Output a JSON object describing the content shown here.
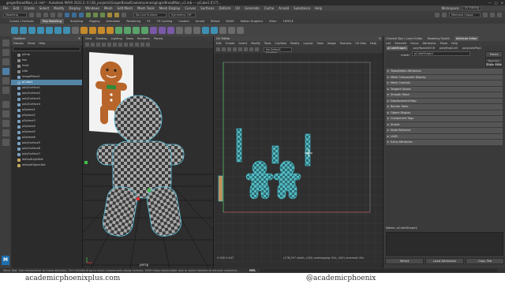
{
  "window": {
    "title": "gingerBreadMan_v1.mb* - Autodesk MAYA 2022.2: E:\\3D_projects\\GingerBreadCookie\\scenes\\gingerBreadMan_v1.mb --- pCube1.f[17]..."
  },
  "menubar": {
    "items": [
      "File",
      "Edit",
      "Create",
      "Select",
      "Modify",
      "Display",
      "Windows",
      "Mesh",
      "Edit Mesh",
      "Mesh Tools",
      "Mesh Display",
      "Curves",
      "Surfaces",
      "Deform",
      "UV",
      "Generate",
      "Cache",
      "Arnold",
      "Substance",
      "Help"
    ],
    "workspace_label": "Workspace:",
    "workspace_value": "UV Editing"
  },
  "status_line": {
    "mode": "Modeling",
    "surface": "No Live Surface",
    "symmetry": "Symmetry: Off",
    "user": "Memoria Coppa"
  },
  "shelf": {
    "tabs": [
      "Curves / Surfaces",
      "Poly Modeling",
      "Sculpting",
      "Rigging",
      "Animation",
      "Rendering",
      "FX",
      "FX Caching",
      "Custom",
      "Arnold",
      "Bifrost",
      "MASH",
      "Motion Graphics",
      "XGen",
      "TURTLE"
    ],
    "active_tab": "Poly Modeling"
  },
  "outliner": {
    "title": "Outliner",
    "menu": [
      "Display",
      "Show",
      "Help"
    ],
    "search_placeholder": "",
    "items": [
      "persp",
      "top",
      "front",
      "side",
      "imagePlane1",
      "pCube1",
      "polySurface1",
      "polySurface2",
      "polySurface3",
      "polySurface4",
      "pSphere1",
      "pSphere2",
      "pSphere3",
      "pSphere4",
      "pSphere5",
      "pSphere6",
      "polySurface5",
      "polySurface6",
      "polySurface7",
      "defaultLightSet",
      "defaultObjectSet"
    ],
    "selected": "pCube1"
  },
  "viewport": {
    "menu": [
      "View",
      "Shading",
      "Lighting",
      "Show",
      "Renderer",
      "Panels"
    ],
    "camera_label": "persp"
  },
  "uv_editor": {
    "title": "UV Editor",
    "menu": [
      "Edit",
      "Create",
      "Select",
      "Modify",
      "Tools",
      "Cut/Sew",
      "Modify",
      "Layout",
      "View",
      "Image",
      "Textures",
      "UV Sets",
      "Help"
    ],
    "uv_set": "No Default Shading",
    "coords": "0.000  0.447",
    "stats_text": "(178,197 shells, (0/0) overlapping UVs, (0/0) reversed UVs"
  },
  "attribute_editor": {
    "tabs": [
      "Channel Box / Layer Editor",
      "Modeling Toolkit",
      "Attribute Editor"
    ],
    "active_tab": "Attribute Editor",
    "header_tabs": [
      "List",
      "Selected",
      "Focus",
      "Attributes",
      "Show",
      "Help"
    ],
    "node_tabs": [
      "pCubeShape1",
      "polyTweakUV16",
      "polyMapCut3",
      "polyAutoProj1"
    ],
    "mesh_label": "mesh:",
    "mesh_value": "pCubeShape1",
    "buttons": [
      "Focus",
      "Presets",
      "Show",
      "Hide"
    ],
    "sections": [
      "Tessellation Attributes",
      "Mesh Component Display",
      "Mesh Controls",
      "Tangent Space",
      "Smooth Mesh",
      "Displacement Map",
      "Render Stats",
      "Object Display",
      "Component Tags",
      "Arnold",
      "Node Behavior",
      "UUID",
      "Extra Attributes"
    ],
    "notes_label": "Notes:",
    "notes_value": "pCubeShape1",
    "bottom_buttons": [
      "Select",
      "Load Attributes",
      "Copy Tab"
    ]
  },
  "helpline": {
    "text": "Move Tool: Use manipulator to move object(s). Ctrl+middle-drag to move components along normals. Shift+drag manipulator axis or plane handles to extrude components or clone objects. Ctrl+Shift+LMB+drag to constrain movement to a connected edge. Use D or INSERT to change the pivot position and axis orientation."
  },
  "command_line": {
    "lang": "MEL"
  },
  "watermark": {
    "left": "academicphoenixplus.com",
    "right": "@academicphoenix"
  },
  "colors": {
    "uv_grid": "#7b7b7b",
    "uv_shell_outline": "#47c8d8",
    "selection": "#5285a6",
    "accent_blue": "#1d6fae"
  }
}
